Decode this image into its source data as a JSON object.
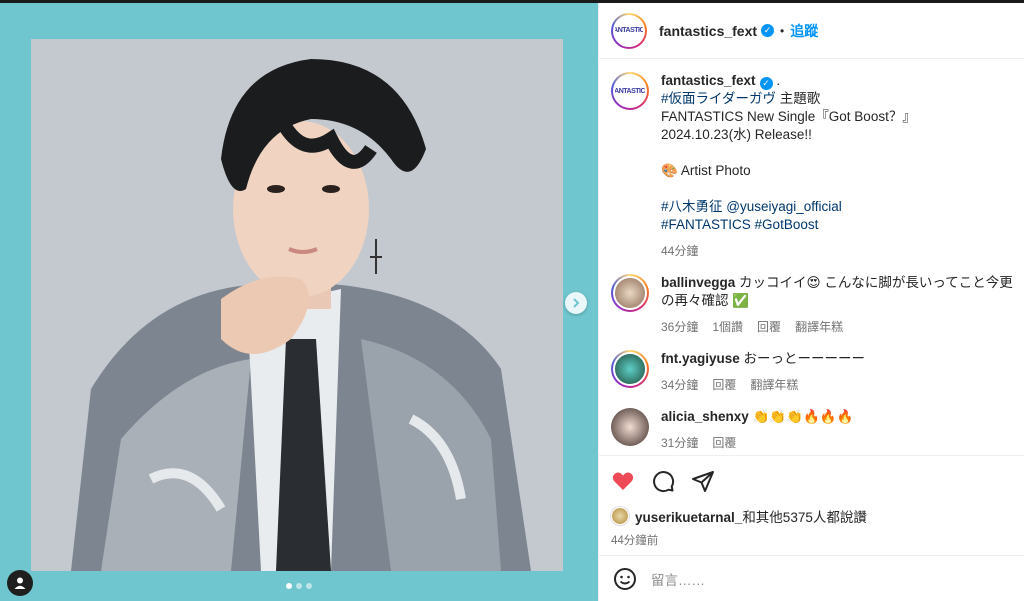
{
  "header": {
    "username": "fantastics_fext",
    "separator": "•",
    "follow_label": "追蹤",
    "avatar_text": "FANTASTICS"
  },
  "caption": {
    "username": "fantastics_fext",
    "trailing": ".",
    "line1_tag": "#仮面ライダーガヴ",
    "line1_text": " 主題歌",
    "line2": "FANTASTICS New Single『Got Boost？』",
    "line3": "2024.10.23(水) Release!!",
    "line4_icon": "🎨",
    "line4_text": " Artist Photo",
    "line5_tag": "#八木勇征",
    "line5_mention": "@yuseiyagi_official",
    "line6_tag1": "#FANTASTICS",
    "line6_tag2": "#GotBoost",
    "time": "44分鐘"
  },
  "comments": [
    {
      "username": "ballinvegga",
      "text": "カッコイイ😍 こんなに脚が長いってこと今更の再々確認 ✅",
      "time": "36分鐘",
      "likes": "1個讚",
      "reply": "回覆",
      "translate": "翻譯年糕"
    },
    {
      "username": "fnt.yagiyuse",
      "text": "おーっとーーーーー",
      "time": "34分鐘",
      "reply": "回覆",
      "translate": "翻譯年糕"
    },
    {
      "username": "alicia_shenxy",
      "text": "👏👏👏🔥🔥🔥",
      "time": "31分鐘",
      "reply": "回覆"
    }
  ],
  "likes": {
    "username": "yuserikuetarnal_",
    "text": "和其他5375人都說讚"
  },
  "post_time": "44分鐘前",
  "add_comment": {
    "placeholder": "留言……"
  },
  "carousel": {
    "slide_count": 3,
    "active_index": 0
  },
  "colors": {
    "media_background": "#6fc6cf",
    "accent_link": "#0095f6",
    "hashtag": "#00376b",
    "like_heart": "#ed4956"
  }
}
